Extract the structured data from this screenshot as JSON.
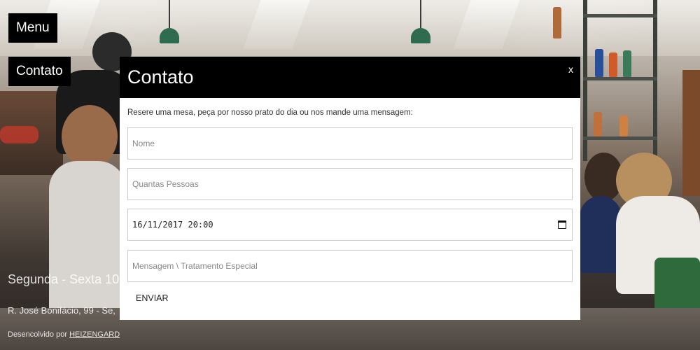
{
  "nav": {
    "menu_label": "Menu",
    "contact_label": "Contato"
  },
  "footer": {
    "hours": "Segunda - Sexta 10",
    "address": "R. José Bonifácio, 99 - Se,",
    "credits_prefix": "Desencolvido por",
    "credits_link": "HEIZENGARD"
  },
  "modal": {
    "title": "Contato",
    "close_label": "x",
    "intro": "Resere uma mesa, peça por nosso prato do dia ou nos mande uma mensagem:",
    "fields": {
      "name_placeholder": "Nome",
      "people_placeholder": "Quantas Pessoas",
      "datetime_value": "16/11/2017 20:00",
      "message_placeholder": "Mensagem \\ Tratamento Especial"
    },
    "submit_label": "ENVIAR"
  },
  "colors": {
    "modal_header": "#000000",
    "modal_body": "#ffffff",
    "nav_button": "#000000"
  }
}
